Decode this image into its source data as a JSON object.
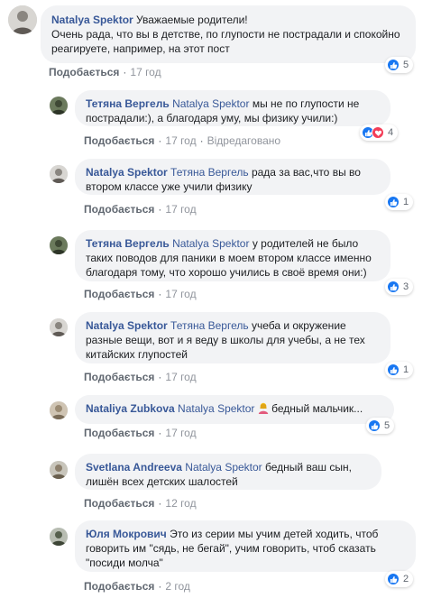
{
  "ui": {
    "like_label": "Подобається",
    "edited_label": "Відредаговано",
    "colors": {
      "author": "#385898",
      "bubble": "#f2f3f5",
      "like_blue": "#1877f2",
      "love_red": "#f33e58"
    }
  },
  "comments": [
    {
      "author": "Natalya Spektor",
      "mention": "",
      "text": "Уважаемые родители!",
      "text2": "Очень рада, что вы в детстве, по глупости не пострадали и спокойно реагируете, например, на этот пост",
      "age": "17 год",
      "reactions": "5"
    },
    {
      "author": "Тетяна Вергель",
      "mention": "Natalya Spektor",
      "text": "мы не по глупости не пострадали:), а благодаря уму, мы физику учили:)",
      "age": "17 год",
      "edited": true,
      "reactions": "4"
    },
    {
      "author": "Natalya Spektor",
      "mention": "Тетяна Вергель",
      "text": "рада за вас,что вы во втором классе уже учили физику",
      "age": "17 год",
      "reactions": "1"
    },
    {
      "author": "Тетяна Вергель",
      "mention": "Natalya Spektor",
      "text": "у родителей не было таких поводов для паники в моем втором классе именно благодаря тому, что хорошо учились в своё время они:)",
      "age": "17 год",
      "reactions": "3"
    },
    {
      "author": "Natalya Spektor",
      "mention": "Тетяна Вергель",
      "text": "учеба и окружение разные вещи, вот и я веду в школы для учебы, а не тех китайских глупостей",
      "age": "17 год",
      "reactions": "1"
    },
    {
      "author": "Nataliya Zubkova",
      "mention": "Natalya Spektor",
      "text": "бедный мальчик...",
      "age": "17 год",
      "reactions": "5"
    },
    {
      "author": "Svetlana Andreeva",
      "mention": "Natalya Spektor",
      "text": "бедный ваш сын, лишён всех детских шалостей",
      "age": "12 год",
      "reactions": ""
    },
    {
      "author": "Юля Мокрович",
      "mention": "",
      "text": "Это из серии мы учим детей ходить, чтоб говорить им \"сядь, не бегай\", учим говорить, чтоб сказать \"посиди молча\"",
      "age": "2 год",
      "reactions": "2"
    }
  ]
}
